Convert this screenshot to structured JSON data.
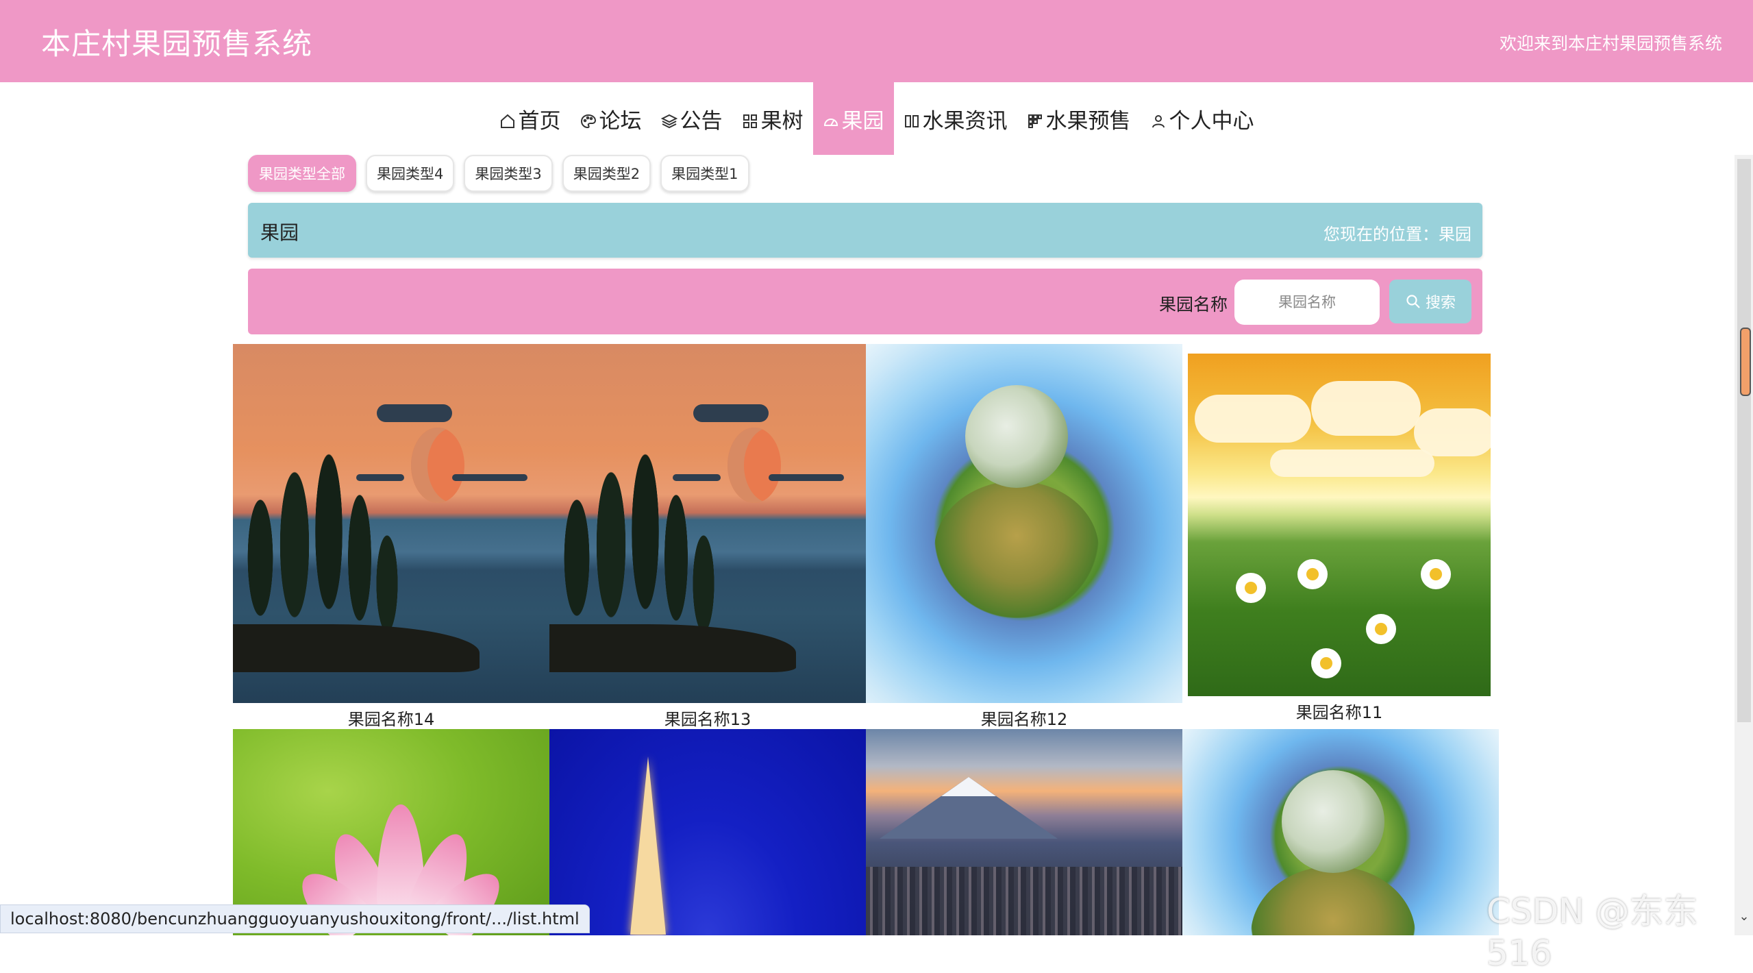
{
  "header": {
    "title": "本庄村果园预售系统",
    "welcome": "欢迎来到本庄村果园预售系统"
  },
  "nav": {
    "items": [
      {
        "label": "首页",
        "icon": "home-icon"
      },
      {
        "label": "论坛",
        "icon": "palette-icon"
      },
      {
        "label": "公告",
        "icon": "layers-icon"
      },
      {
        "label": "果树",
        "icon": "grid-icon"
      },
      {
        "label": "果园",
        "icon": "gauge-icon",
        "active": true
      },
      {
        "label": "水果资讯",
        "icon": "columns-icon"
      },
      {
        "label": "水果预售",
        "icon": "apps-icon"
      },
      {
        "label": "个人中心",
        "icon": "user-icon"
      }
    ]
  },
  "filters": {
    "items": [
      {
        "label": "果园类型全部",
        "active": true
      },
      {
        "label": "果园类型4"
      },
      {
        "label": "果园类型3"
      },
      {
        "label": "果园类型2"
      },
      {
        "label": "果园类型1"
      }
    ]
  },
  "breadcrumb": {
    "title": "果园",
    "location": "您现在的位置：果园"
  },
  "search": {
    "label": "果园名称",
    "placeholder": "果园名称",
    "button": "搜索"
  },
  "gallery": {
    "items": [
      {
        "name": "果园名称14",
        "image": "lake-sunset-moon"
      },
      {
        "name": "果园名称13",
        "image": "lake-sunset-moon"
      },
      {
        "name": "果园名称12",
        "image": "tiny-planet-tree"
      },
      {
        "name": "果园名称11",
        "image": "daisy-field-sunset"
      },
      {
        "name": "",
        "image": "pink-lotus"
      },
      {
        "name": "",
        "image": "eiffel-tower-night"
      },
      {
        "name": "",
        "image": "mount-fuji-city"
      },
      {
        "name": "",
        "image": "tiny-planet-tree"
      }
    ]
  },
  "status": {
    "url": "localhost:8080/bencunzhuangguoyuanyushouxitong/front/.../list.html"
  },
  "watermark": "CSDN @东东516",
  "colors": {
    "primary_pink": "#ef98c6",
    "accent_teal": "#99d1da"
  }
}
